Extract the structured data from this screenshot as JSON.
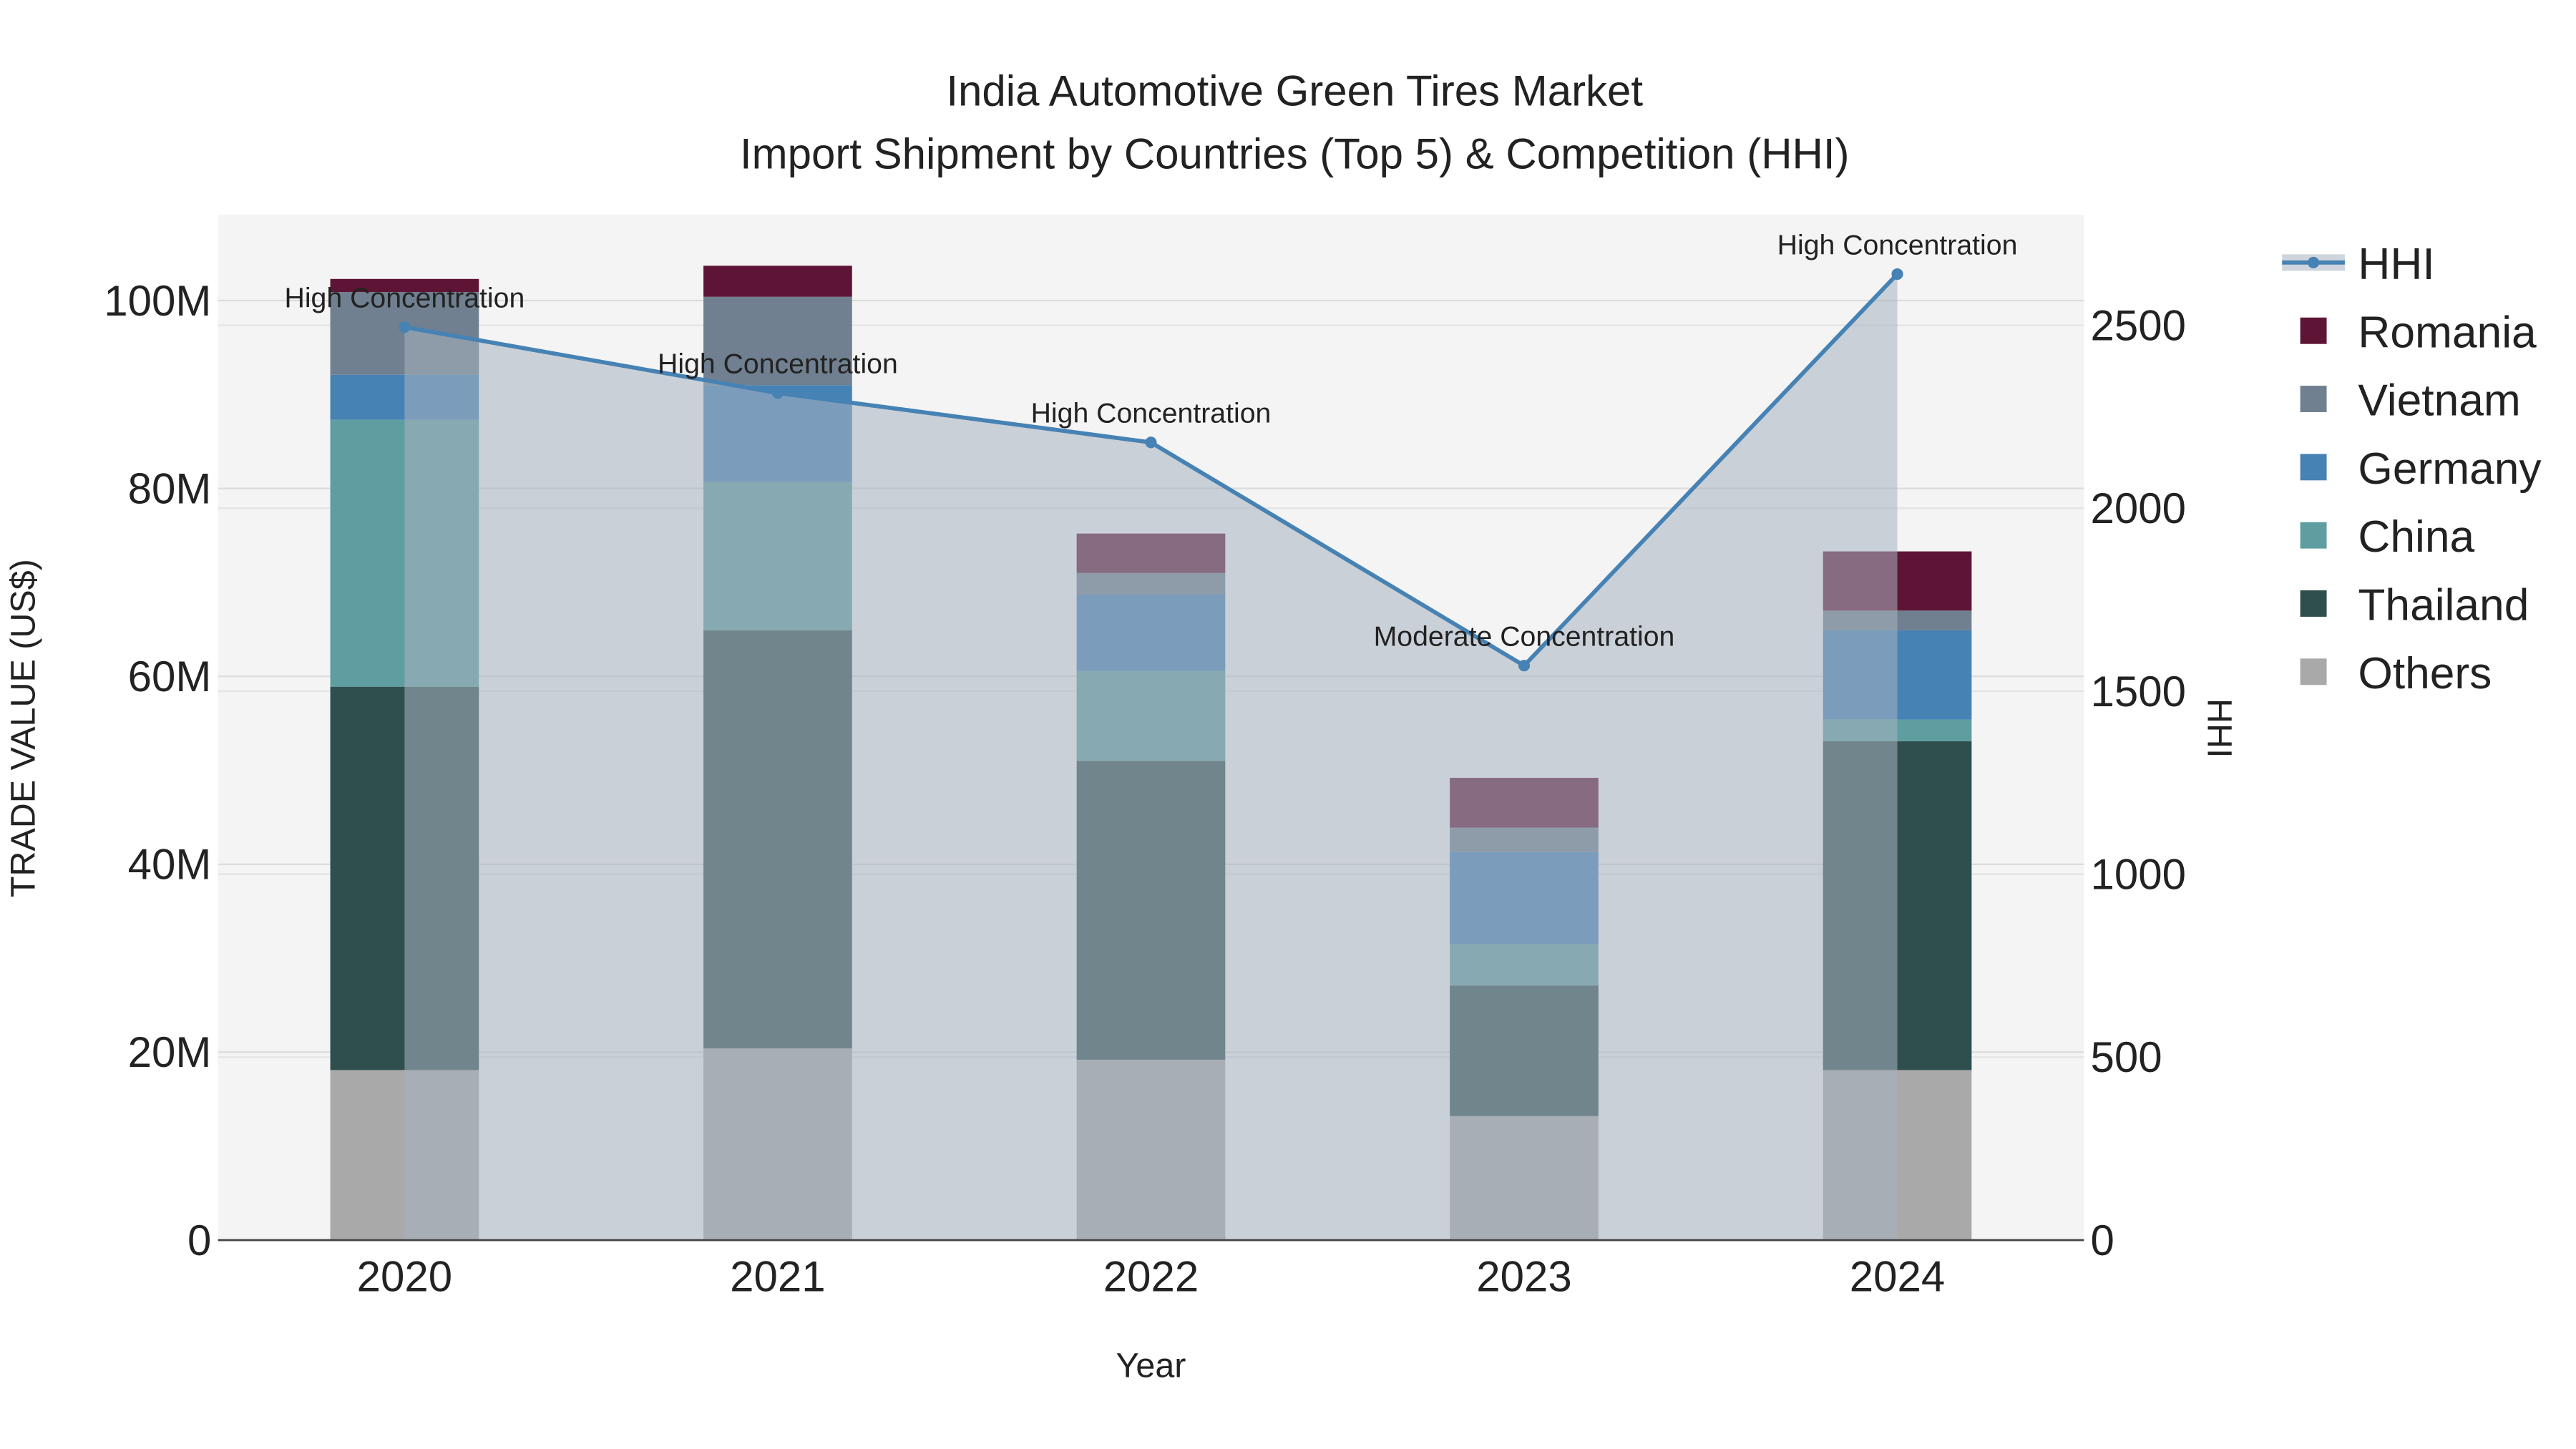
{
  "chart_data": {
    "type": "bar",
    "title": "India Automotive Green Tires Market",
    "subtitle": "Import Shipment by Countries (Top 5) & Competition (HHI)",
    "xlabel": "Year",
    "ylabel": "TRADE VALUE (US$)",
    "y2label": "HHI",
    "categories": [
      "2020",
      "2021",
      "2022",
      "2023",
      "2024"
    ],
    "ylim": [
      0,
      108
    ],
    "y_unit": "M",
    "yticks": [
      "0",
      "20M",
      "40M",
      "60M",
      "80M",
      "100M"
    ],
    "y2lim": [
      0,
      2800
    ],
    "y2ticks": [
      "0",
      "500",
      "1000",
      "1500",
      "2000",
      "2500"
    ],
    "grid": true,
    "legend_position": "right",
    "stacked": true,
    "series": [
      {
        "name": "Others",
        "color": "#a9a9a9",
        "values": [
          18.1,
          20.4,
          19.2,
          13.2,
          18.1
        ]
      },
      {
        "name": "Thailand",
        "color": "#2f4f4f",
        "values": [
          40.8,
          44.5,
          31.8,
          13.9,
          35.0
        ]
      },
      {
        "name": "China",
        "color": "#5f9ea0",
        "values": [
          28.4,
          15.8,
          9.6,
          4.4,
          2.3
        ]
      },
      {
        "name": "Germany",
        "color": "#4682b4",
        "values": [
          4.8,
          10.3,
          8.1,
          9.8,
          9.5
        ]
      },
      {
        "name": "Vietnam",
        "color": "#708090",
        "values": [
          8.8,
          9.4,
          2.3,
          2.6,
          2.1
        ]
      },
      {
        "name": "Romania",
        "color": "#5e1535",
        "values": [
          1.4,
          3.3,
          4.2,
          5.3,
          6.3
        ]
      }
    ],
    "hhi": {
      "name": "HHI",
      "color": "#4682b4",
      "values": [
        2495,
        2315,
        2180,
        1570,
        2640
      ],
      "annotations": [
        "High Concentration",
        "High Concentration",
        "High Concentration",
        "Moderate Concentration",
        "High Concentration"
      ]
    },
    "legend": [
      "HHI",
      "Romania",
      "Vietnam",
      "Germany",
      "China",
      "Thailand",
      "Others"
    ]
  }
}
